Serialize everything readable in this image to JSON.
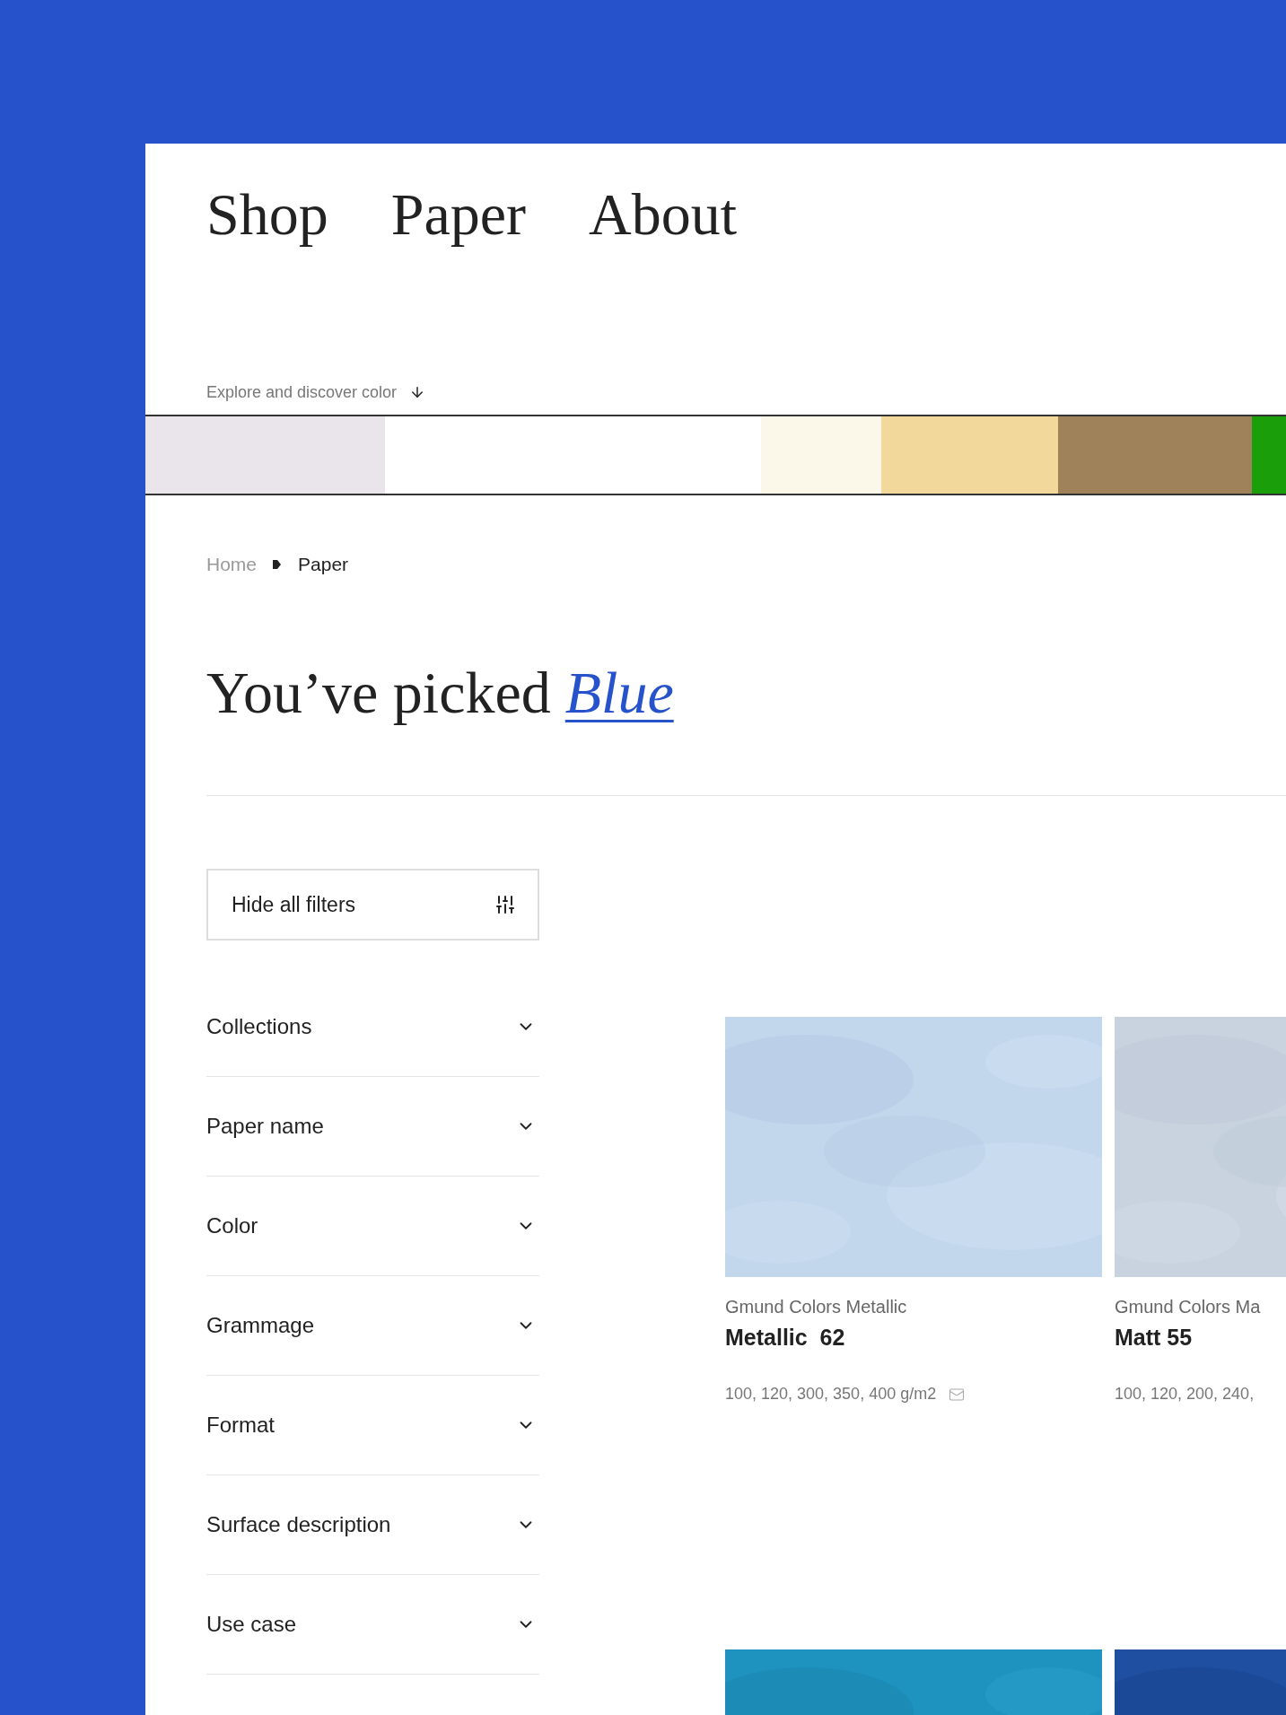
{
  "nav": [
    "Shop",
    "Paper",
    "About"
  ],
  "explore": "Explore and discover color",
  "swatches": [
    {
      "color": "#e9e5ea"
    },
    {
      "color": "#fbf8ea"
    },
    {
      "color": "#f2d99b"
    },
    {
      "color": "#a0825a"
    },
    {
      "color": "#1a9e0a"
    }
  ],
  "breadcrumb": [
    {
      "label": "Home",
      "selected": false
    },
    {
      "label": "Paper",
      "selected": true
    }
  ],
  "heading": {
    "text": "You’ve picked",
    "color_name": "Blue"
  },
  "filter_button": "Hide all filters",
  "filters": [
    {
      "label": "Collections",
      "expanded": false
    },
    {
      "label": "Paper name",
      "expanded": false
    },
    {
      "label": "Color",
      "expanded": false
    },
    {
      "label": "Grammage",
      "expanded": false
    },
    {
      "label": "Format",
      "expanded": false
    },
    {
      "label": "Surface description",
      "expanded": false
    },
    {
      "label": "Use case",
      "expanded": false
    }
  ],
  "products": [
    {
      "kind": "product",
      "collection": "Gmund Colors Metallic",
      "name": "Metallic  62",
      "weights": "100, 120, 300, 350, 400 g/m2",
      "mail": true
    },
    {
      "kind": "product",
      "collection": "Gmund Colors Ma",
      "name": "Matt 55",
      "weights": "100, 120, 200, 240,"
    },
    {
      "kind": "picture"
    },
    {
      "kind": "picture"
    }
  ]
}
